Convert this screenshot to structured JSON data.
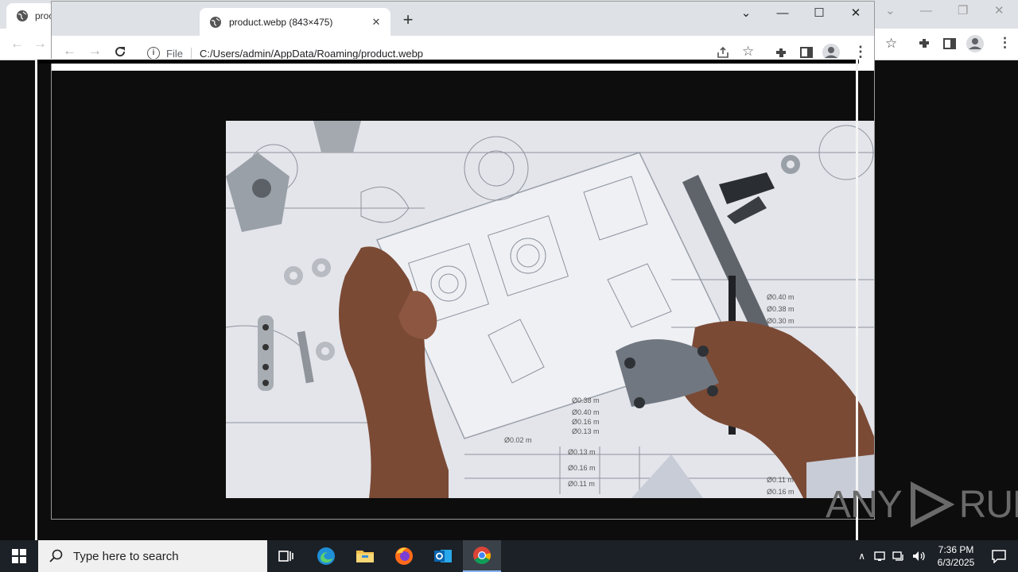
{
  "back_window": {
    "tab_title": "proc",
    "controls": {
      "dropdown": "⌄",
      "minimize": "—",
      "restore": "❐",
      "close": "✕"
    }
  },
  "front_window": {
    "tab_title": "product.webp (843×475)",
    "tab_close": "✕",
    "new_tab": "+",
    "controls": {
      "dropdown": "⌄",
      "minimize": "—",
      "maximize": "☐",
      "close": "✕"
    },
    "address": {
      "scheme_label": "File",
      "url": "C:/Users/admin/AppData/Roaming/product.webp"
    }
  },
  "image": {
    "description_icon": "engineering-blueprint-photo"
  },
  "watermark": {
    "text": "ANY",
    "text2": "RUN"
  },
  "taskbar": {
    "search_placeholder": "Type here to search",
    "clock_time": "7:36 PM",
    "clock_date": "6/3/2025",
    "apps": [
      "task-view",
      "edge",
      "file-explorer",
      "firefox",
      "outlook",
      "chrome"
    ]
  }
}
